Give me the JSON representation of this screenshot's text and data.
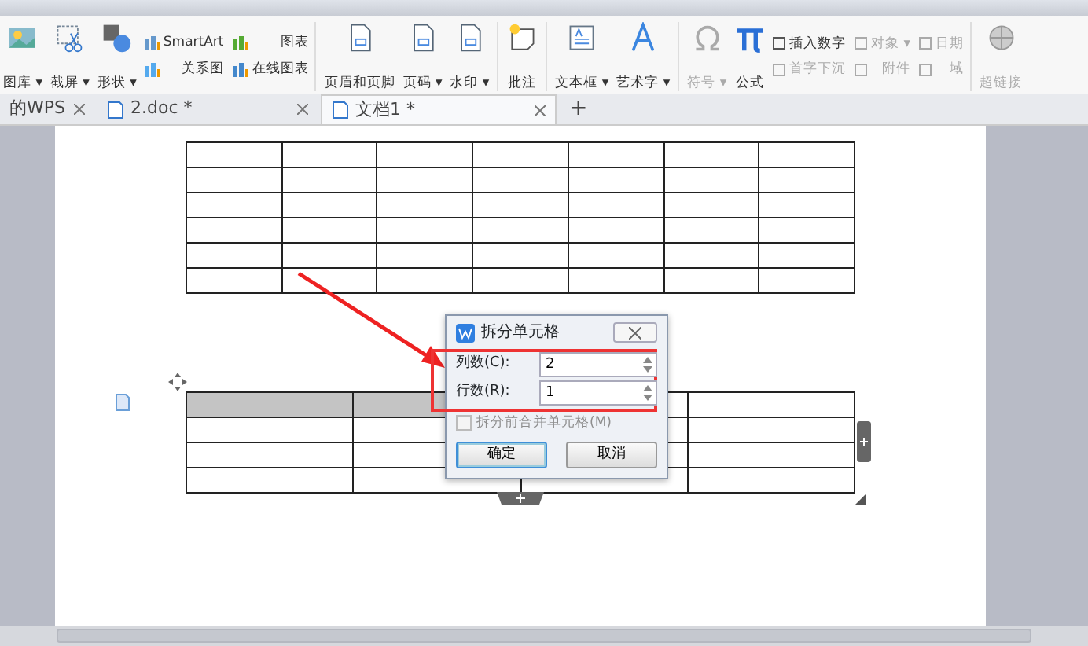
{
  "ribbon": {
    "items": [
      {
        "kind": "big",
        "label": "图库 ▾"
      },
      {
        "kind": "big",
        "label": "截屏 ▾"
      },
      {
        "kind": "big",
        "label": "形状 ▾"
      },
      {
        "kind": "pair",
        "top": "SmartArt",
        "bottom": "关系图",
        "top2": "图表",
        "bottom2": "在线图表"
      },
      {
        "kind": "sep"
      },
      {
        "kind": "big",
        "label": "页眉和页脚"
      },
      {
        "kind": "big",
        "label": "页码 ▾"
      },
      {
        "kind": "big",
        "label": "水印 ▾"
      },
      {
        "kind": "sep"
      },
      {
        "kind": "big",
        "label": "批注"
      },
      {
        "kind": "sep"
      },
      {
        "kind": "big",
        "label": "文本框 ▾"
      },
      {
        "kind": "big",
        "label": "艺术字 ▾"
      },
      {
        "kind": "sep"
      },
      {
        "kind": "big",
        "label": "符号 ▾",
        "disabled": true
      },
      {
        "kind": "big",
        "label": "公式",
        "disabled": false
      },
      {
        "kind": "grid",
        "cells": [
          {
            "label": "插入数字",
            "disabled": false
          },
          {
            "label": "对象 ▾",
            "disabled": true
          },
          {
            "label": "日期",
            "disabled": true
          },
          {
            "label": "首字下沉",
            "disabled": true
          },
          {
            "label": "附件",
            "disabled": true
          },
          {
            "label": "域",
            "disabled": true
          }
        ]
      },
      {
        "kind": "sep"
      },
      {
        "kind": "big",
        "label": "超链接",
        "disabled": true
      }
    ]
  },
  "doc_tabs": [
    {
      "label": "的WPS",
      "selected": false
    },
    {
      "label": "2.doc *",
      "selected": false
    },
    {
      "label": "文档1 *",
      "selected": true
    }
  ],
  "new_tab": "+",
  "second_table": {
    "first_row": [
      {
        "selected": true
      },
      {
        "selected": true
      },
      {
        "selected": false
      },
      {
        "selected": false
      }
    ]
  },
  "dialog": {
    "title": "拆分单元格",
    "fields": [
      {
        "label": "列数(C):",
        "value": "2"
      },
      {
        "label": "行数(R):",
        "value": "1"
      }
    ],
    "checkbox": {
      "label": "拆分前合并单元格(M)",
      "checked": false,
      "disabled": true
    },
    "buttons": [
      {
        "label": "确定",
        "default": true
      },
      {
        "label": "取消",
        "default": false
      }
    ]
  }
}
